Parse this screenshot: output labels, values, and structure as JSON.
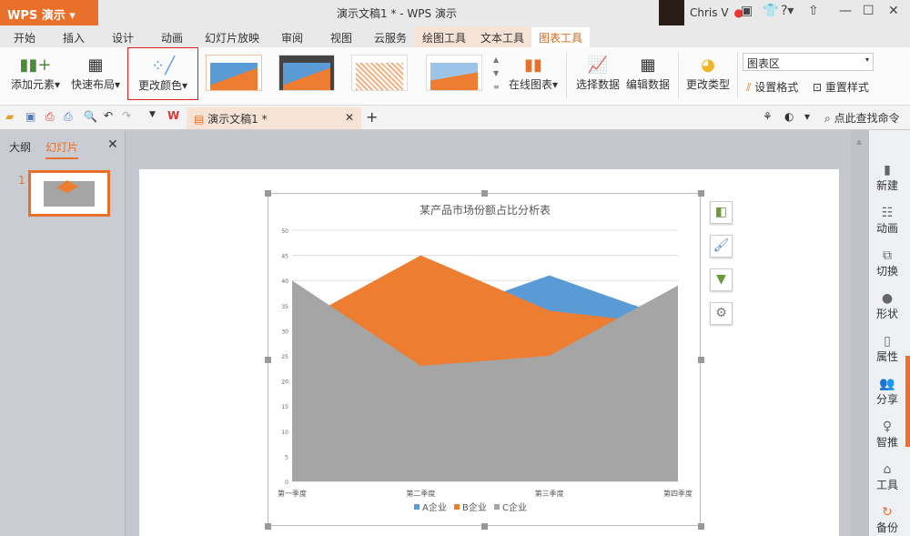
{
  "app": {
    "logo": "WPS 演示",
    "title": "演示文稿1 * - WPS 演示",
    "user": "Chris V"
  },
  "tabs": [
    "开始",
    "插入",
    "设计",
    "动画",
    "幻灯片放映",
    "审阅",
    "视图",
    "云服务",
    "绘图工具",
    "文本工具",
    "图表工具"
  ],
  "ribbon": {
    "add_element": "添加元素",
    "quick_layout": "快速布局",
    "change_color": "更改颜色",
    "online_chart": "在线图表",
    "select_data": "选择数据",
    "edit_data": "编辑数据",
    "change_type": "更改类型",
    "area_select": "图表区",
    "set_format": "设置格式",
    "reset_style": "重置样式"
  },
  "quickbar": {
    "doc_tab": "演示文稿1 *",
    "search": "点此查找命令"
  },
  "leftpanel": {
    "tab_outline": "大纲",
    "tab_slides": "幻灯片",
    "slide_number": "1"
  },
  "rightbar": [
    "新建",
    "动画",
    "切换",
    "形状",
    "属性",
    "分享",
    "智推",
    "工具",
    "备份"
  ],
  "colors": {
    "accent": "#e8702a",
    "A": "#5b9bd5",
    "B": "#ed7d31",
    "C": "#a5a5a5"
  },
  "chart_data": {
    "type": "area",
    "title": "某产品市场份额占比分析表",
    "categories": [
      "第一季度",
      "第二季度",
      "第三季度",
      "第四季度"
    ],
    "series": [
      {
        "name": "A企业",
        "values": [
          30,
          32,
          41,
          32
        ]
      },
      {
        "name": "B企业",
        "values": [
          31,
          45,
          34,
          31
        ]
      },
      {
        "name": "C企业",
        "values": [
          40,
          23,
          25,
          39
        ]
      }
    ],
    "yticks": [
      "0",
      "5",
      "10",
      "15",
      "20",
      "25",
      "30",
      "35",
      "40",
      "45",
      "50"
    ],
    "ylim": [
      0,
      50
    ],
    "grid": true,
    "legend": "bottom"
  }
}
